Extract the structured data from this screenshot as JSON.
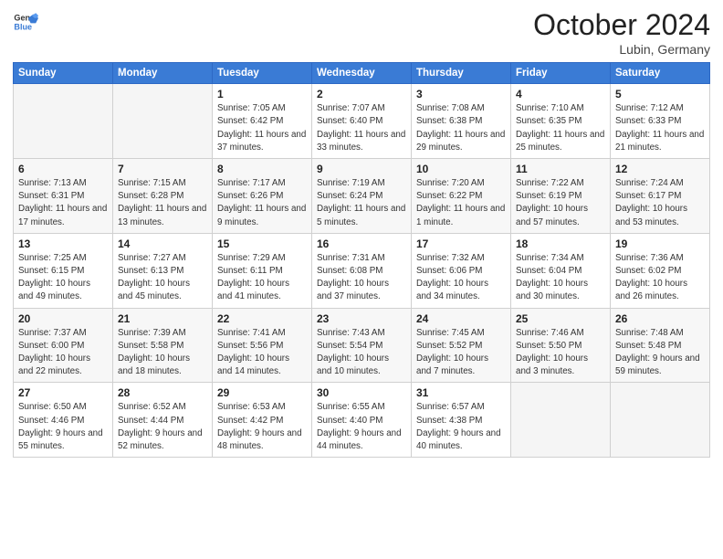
{
  "header": {
    "logo_general": "General",
    "logo_blue": "Blue",
    "month_title": "October 2024",
    "location": "Lubin, Germany"
  },
  "weekdays": [
    "Sunday",
    "Monday",
    "Tuesday",
    "Wednesday",
    "Thursday",
    "Friday",
    "Saturday"
  ],
  "weeks": [
    [
      {
        "day": "",
        "detail": ""
      },
      {
        "day": "",
        "detail": ""
      },
      {
        "day": "1",
        "detail": "Sunrise: 7:05 AM\nSunset: 6:42 PM\nDaylight: 11 hours and 37 minutes."
      },
      {
        "day": "2",
        "detail": "Sunrise: 7:07 AM\nSunset: 6:40 PM\nDaylight: 11 hours and 33 minutes."
      },
      {
        "day": "3",
        "detail": "Sunrise: 7:08 AM\nSunset: 6:38 PM\nDaylight: 11 hours and 29 minutes."
      },
      {
        "day": "4",
        "detail": "Sunrise: 7:10 AM\nSunset: 6:35 PM\nDaylight: 11 hours and 25 minutes."
      },
      {
        "day": "5",
        "detail": "Sunrise: 7:12 AM\nSunset: 6:33 PM\nDaylight: 11 hours and 21 minutes."
      }
    ],
    [
      {
        "day": "6",
        "detail": "Sunrise: 7:13 AM\nSunset: 6:31 PM\nDaylight: 11 hours and 17 minutes."
      },
      {
        "day": "7",
        "detail": "Sunrise: 7:15 AM\nSunset: 6:28 PM\nDaylight: 11 hours and 13 minutes."
      },
      {
        "day": "8",
        "detail": "Sunrise: 7:17 AM\nSunset: 6:26 PM\nDaylight: 11 hours and 9 minutes."
      },
      {
        "day": "9",
        "detail": "Sunrise: 7:19 AM\nSunset: 6:24 PM\nDaylight: 11 hours and 5 minutes."
      },
      {
        "day": "10",
        "detail": "Sunrise: 7:20 AM\nSunset: 6:22 PM\nDaylight: 11 hours and 1 minute."
      },
      {
        "day": "11",
        "detail": "Sunrise: 7:22 AM\nSunset: 6:19 PM\nDaylight: 10 hours and 57 minutes."
      },
      {
        "day": "12",
        "detail": "Sunrise: 7:24 AM\nSunset: 6:17 PM\nDaylight: 10 hours and 53 minutes."
      }
    ],
    [
      {
        "day": "13",
        "detail": "Sunrise: 7:25 AM\nSunset: 6:15 PM\nDaylight: 10 hours and 49 minutes."
      },
      {
        "day": "14",
        "detail": "Sunrise: 7:27 AM\nSunset: 6:13 PM\nDaylight: 10 hours and 45 minutes."
      },
      {
        "day": "15",
        "detail": "Sunrise: 7:29 AM\nSunset: 6:11 PM\nDaylight: 10 hours and 41 minutes."
      },
      {
        "day": "16",
        "detail": "Sunrise: 7:31 AM\nSunset: 6:08 PM\nDaylight: 10 hours and 37 minutes."
      },
      {
        "day": "17",
        "detail": "Sunrise: 7:32 AM\nSunset: 6:06 PM\nDaylight: 10 hours and 34 minutes."
      },
      {
        "day": "18",
        "detail": "Sunrise: 7:34 AM\nSunset: 6:04 PM\nDaylight: 10 hours and 30 minutes."
      },
      {
        "day": "19",
        "detail": "Sunrise: 7:36 AM\nSunset: 6:02 PM\nDaylight: 10 hours and 26 minutes."
      }
    ],
    [
      {
        "day": "20",
        "detail": "Sunrise: 7:37 AM\nSunset: 6:00 PM\nDaylight: 10 hours and 22 minutes."
      },
      {
        "day": "21",
        "detail": "Sunrise: 7:39 AM\nSunset: 5:58 PM\nDaylight: 10 hours and 18 minutes."
      },
      {
        "day": "22",
        "detail": "Sunrise: 7:41 AM\nSunset: 5:56 PM\nDaylight: 10 hours and 14 minutes."
      },
      {
        "day": "23",
        "detail": "Sunrise: 7:43 AM\nSunset: 5:54 PM\nDaylight: 10 hours and 10 minutes."
      },
      {
        "day": "24",
        "detail": "Sunrise: 7:45 AM\nSunset: 5:52 PM\nDaylight: 10 hours and 7 minutes."
      },
      {
        "day": "25",
        "detail": "Sunrise: 7:46 AM\nSunset: 5:50 PM\nDaylight: 10 hours and 3 minutes."
      },
      {
        "day": "26",
        "detail": "Sunrise: 7:48 AM\nSunset: 5:48 PM\nDaylight: 9 hours and 59 minutes."
      }
    ],
    [
      {
        "day": "27",
        "detail": "Sunrise: 6:50 AM\nSunset: 4:46 PM\nDaylight: 9 hours and 55 minutes."
      },
      {
        "day": "28",
        "detail": "Sunrise: 6:52 AM\nSunset: 4:44 PM\nDaylight: 9 hours and 52 minutes."
      },
      {
        "day": "29",
        "detail": "Sunrise: 6:53 AM\nSunset: 4:42 PM\nDaylight: 9 hours and 48 minutes."
      },
      {
        "day": "30",
        "detail": "Sunrise: 6:55 AM\nSunset: 4:40 PM\nDaylight: 9 hours and 44 minutes."
      },
      {
        "day": "31",
        "detail": "Sunrise: 6:57 AM\nSunset: 4:38 PM\nDaylight: 9 hours and 40 minutes."
      },
      {
        "day": "",
        "detail": ""
      },
      {
        "day": "",
        "detail": ""
      }
    ]
  ]
}
